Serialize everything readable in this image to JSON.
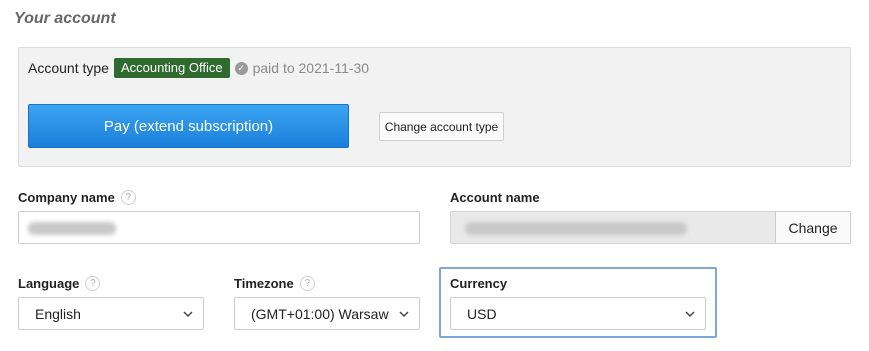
{
  "section": {
    "title": "Your account"
  },
  "account_type": {
    "label": "Account type",
    "badge": "Accounting Office",
    "badge_color": "#2f6b2f",
    "status_icon": "check-circle-icon",
    "paid_text": "paid to 2021-11-30"
  },
  "buttons": {
    "pay": "Pay (extend subscription)",
    "pay_color": "#1b7fdb",
    "change_account_type": "Change account type",
    "change": "Change"
  },
  "company": {
    "label": "Company name",
    "help_icon": "help-icon",
    "help": "?"
  },
  "account_name": {
    "label": "Account name"
  },
  "language": {
    "label": "Language",
    "help": "?",
    "value": "English"
  },
  "timezone": {
    "label": "Timezone",
    "help": "?",
    "value": "(GMT+01:00) Warsaw"
  },
  "currency": {
    "label": "Currency",
    "value": "USD",
    "focus_color": "#7ea6d9"
  }
}
